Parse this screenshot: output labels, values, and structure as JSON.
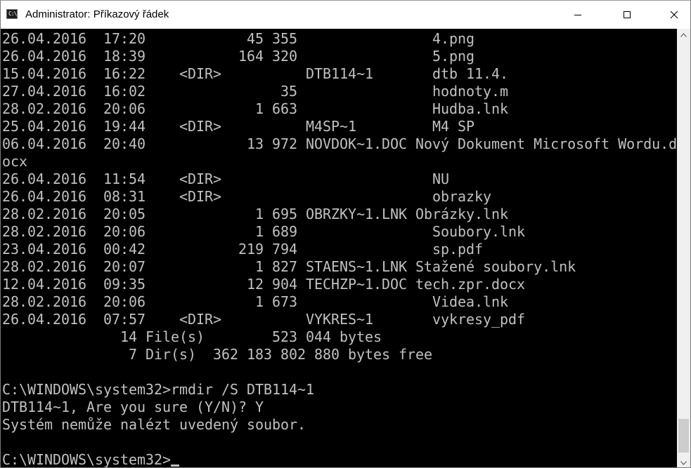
{
  "window": {
    "title": "Administrator: Příkazový řádek",
    "icon": "cmd-icon",
    "controls": [
      "minimize-icon",
      "maximize-icon",
      "close-icon"
    ]
  },
  "console": {
    "lines": [
      "26.04.2016  17:20            45 355                4.png",
      "26.04.2016  18:39           164 320                5.png",
      "15.04.2016  16:22    <DIR>          DTB114~1       dtb 11.4.",
      "27.04.2016  16:02                35                hodnoty.m",
      "28.02.2016  20:06             1 663                Hudba.lnk",
      "25.04.2016  19:44    <DIR>          M4SP~1         M4 SP",
      "06.04.2016  20:40            13 972 NOVDOK~1.DOC Nový Dokument Microsoft Wordu.d",
      "ocx",
      "26.04.2016  11:54    <DIR>                         NU",
      "26.04.2016  08:31    <DIR>                         obrazky",
      "28.02.2016  20:05             1 695 OBRZKY~1.LNK Obrázky.lnk",
      "28.02.2016  20:06             1 689                Soubory.lnk",
      "23.04.2016  00:42           219 794                sp.pdf",
      "28.02.2016  20:07             1 827 STAENS~1.LNK Stažené soubory.lnk",
      "12.04.2016  09:35            12 904 TECHZP~1.DOC tech.zpr.docx",
      "28.02.2016  20:06             1 673                Videa.lnk",
      "26.04.2016  07:57    <DIR>          VYKRES~1       vykresy_pdf",
      "              14 File(s)        523 044 bytes",
      "               7 Dir(s)  362 183 802 880 bytes free",
      "",
      "C:\\WINDOWS\\system32>rmdir /S DTB114~1",
      "DTB114~1, Are you sure (Y/N)? Y",
      "Systém nemůže nalézt uvedený soubor.",
      ""
    ],
    "prompt": "C:\\WINDOWS\\system32>"
  },
  "colors": {
    "console_bg": "#000000",
    "console_fg": "#c0c0c0",
    "titlebar_bg": "#ffffff",
    "scrollbar_track": "#f0f0f0",
    "scrollbar_thumb": "#cdcdcd"
  }
}
